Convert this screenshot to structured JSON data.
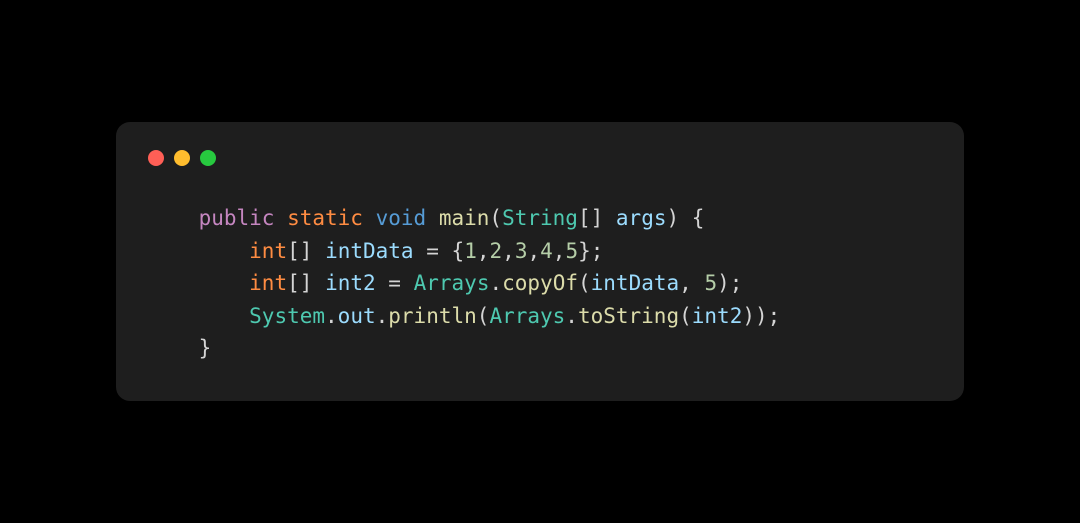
{
  "window": {
    "traffic_lights": {
      "close": "close",
      "minimize": "minimize",
      "zoom": "zoom"
    }
  },
  "code": {
    "indent1": "    ",
    "indent2": "        ",
    "line1": {
      "public": "public",
      "static": "static",
      "void": "void",
      "main": "main",
      "lparen": "(",
      "string": "String",
      "lbracket": "[",
      "rbracket": "]",
      "args": "args",
      "rparen": ")",
      "lbrace": "{"
    },
    "line2": {
      "int": "int",
      "lbracket": "[",
      "rbracket": "]",
      "intData": "intData",
      "eq": "=",
      "lbrace": "{",
      "n1": "1",
      "c1": ",",
      "n2": "2",
      "c2": ",",
      "n3": "3",
      "c3": ",",
      "n4": "4",
      "c4": ",",
      "n5": "5",
      "rbrace": "}",
      "semi": ";"
    },
    "line3": {
      "int": "int",
      "lbracket": "[",
      "rbracket": "]",
      "int2": "int2",
      "eq": "=",
      "arrays": "Arrays",
      "dot": ".",
      "copyOf": "copyOf",
      "lparen": "(",
      "intData": "intData",
      "comma": ",",
      "five": "5",
      "rparen": ")",
      "semi": ";"
    },
    "line4": {
      "system": "System",
      "dot1": ".",
      "out": "out",
      "dot2": ".",
      "println": "println",
      "lparen": "(",
      "arrays": "Arrays",
      "dot3": ".",
      "toString": "toString",
      "lparen2": "(",
      "int2": "int2",
      "rparen2": ")",
      "rparen": ")",
      "semi": ";"
    },
    "line5": {
      "rbrace": "}"
    }
  }
}
